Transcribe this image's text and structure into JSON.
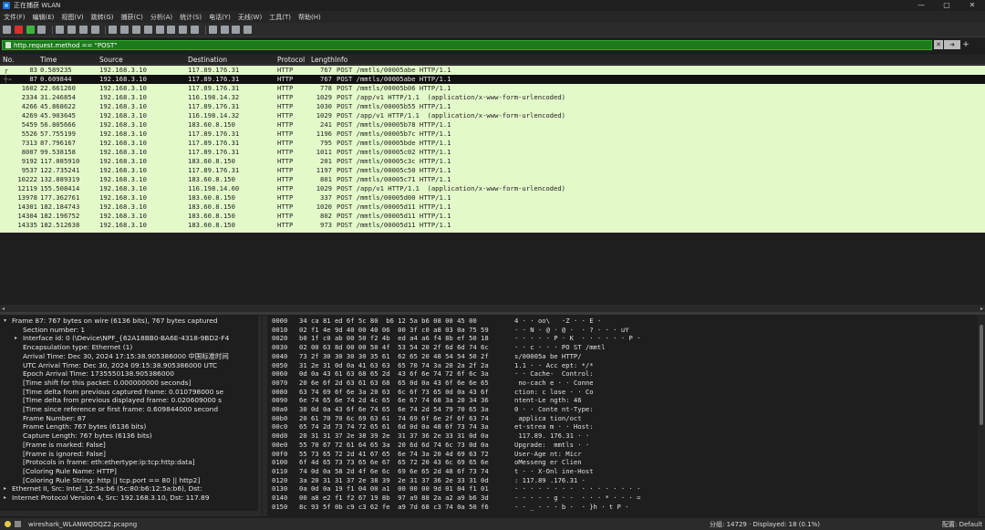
{
  "window": {
    "title": "正在捕获 WLAN",
    "controls": [
      "—",
      "▢",
      "✕"
    ]
  },
  "menu": [
    "文件(F)",
    "编辑(E)",
    "视图(V)",
    "跳转(G)",
    "捕获(C)",
    "分析(A)",
    "统计(S)",
    "电话(Y)",
    "无线(W)",
    "工具(T)",
    "帮助(H)"
  ],
  "filter": {
    "value": "http.request.method == \"POST\""
  },
  "columns": {
    "no": "No.",
    "time": "Time",
    "source": "Source",
    "destination": "Destination",
    "protocol": "Protocol",
    "length": "Length",
    "info": "Info"
  },
  "packets": [
    {
      "no": "83",
      "time": "0.589235",
      "src": "192.168.3.10",
      "dst": "117.89.176.31",
      "proto": "HTTP",
      "len": "767",
      "info": "POST /mmtls/00005abe HTTP/1.1"
    },
    {
      "no": "87",
      "time": "0.609844",
      "src": "192.168.3.10",
      "dst": "117.89.176.31",
      "proto": "HTTP",
      "len": "767",
      "info": "POST /mmtls/00005abe HTTP/1.1",
      "selected": true
    },
    {
      "no": "1602",
      "time": "22.661260",
      "src": "192.168.3.10",
      "dst": "117.89.176.31",
      "proto": "HTTP",
      "len": "778",
      "info": "POST /mmtls/00005b06 HTTP/1.1"
    },
    {
      "no": "2334",
      "time": "31.246854",
      "src": "192.168.3.10",
      "dst": "116.198.14.32",
      "proto": "HTTP",
      "len": "1029",
      "info": "POST /app/v1 HTTP/1.1  (application/x-www-form-urlencoded)"
    },
    {
      "no": "4266",
      "time": "45.868622",
      "src": "192.168.3.10",
      "dst": "117.89.176.31",
      "proto": "HTTP",
      "len": "1030",
      "info": "POST /mmtls/00005b55 HTTP/1.1"
    },
    {
      "no": "4269",
      "time": "45.903645",
      "src": "192.168.3.10",
      "dst": "116.198.14.32",
      "proto": "HTTP",
      "len": "1029",
      "info": "POST /app/v1 HTTP/1.1  (application/x-www-form-urlencoded)"
    },
    {
      "no": "5459",
      "time": "56.805666",
      "src": "192.168.3.10",
      "dst": "183.60.8.150",
      "proto": "HTTP",
      "len": "241",
      "info": "POST /mmtls/00005b78 HTTP/1.1"
    },
    {
      "no": "5526",
      "time": "57.755199",
      "src": "192.168.3.10",
      "dst": "117.89.176.31",
      "proto": "HTTP",
      "len": "1196",
      "info": "POST /mmtls/00005b7c HTTP/1.1"
    },
    {
      "no": "7313",
      "time": "87.796167",
      "src": "192.168.3.10",
      "dst": "117.89.176.31",
      "proto": "HTTP",
      "len": "795",
      "info": "POST /mmtls/00005bde HTTP/1.1"
    },
    {
      "no": "8007",
      "time": "99.538158",
      "src": "192.168.3.10",
      "dst": "117.89.176.31",
      "proto": "HTTP",
      "len": "1011",
      "info": "POST /mmtls/00005c02 HTTP/1.1"
    },
    {
      "no": "9192",
      "time": "117.085910",
      "src": "192.168.3.10",
      "dst": "183.60.8.150",
      "proto": "HTTP",
      "len": "201",
      "info": "POST /mmtls/00005c3c HTTP/1.1"
    },
    {
      "no": "9537",
      "time": "122.735241",
      "src": "192.168.3.10",
      "dst": "117.89.176.31",
      "proto": "HTTP",
      "len": "1197",
      "info": "POST /mmtls/00005c50 HTTP/1.1"
    },
    {
      "no": "10222",
      "time": "132.889319",
      "src": "192.168.3.10",
      "dst": "183.60.8.150",
      "proto": "HTTP",
      "len": "801",
      "info": "POST /mmtls/00005c71 HTTP/1.1"
    },
    {
      "no": "12119",
      "time": "155.508414",
      "src": "192.168.3.10",
      "dst": "116.198.14.60",
      "proto": "HTTP",
      "len": "1029",
      "info": "POST /app/v1 HTTP/1.1  (application/x-www-form-urlencoded)"
    },
    {
      "no": "13978",
      "time": "177.362761",
      "src": "192.168.3.10",
      "dst": "183.60.8.150",
      "proto": "HTTP",
      "len": "337",
      "info": "POST /mmtls/00005d00 HTTP/1.1"
    },
    {
      "no": "14301",
      "time": "182.184743",
      "src": "192.168.3.10",
      "dst": "183.60.8.150",
      "proto": "HTTP",
      "len": "1020",
      "info": "POST /mmtls/00005d11 HTTP/1.1"
    },
    {
      "no": "14304",
      "time": "182.196752",
      "src": "192.168.3.10",
      "dst": "183.60.8.150",
      "proto": "HTTP",
      "len": "802",
      "info": "POST /mmtls/00005d11 HTTP/1.1"
    },
    {
      "no": "14335",
      "time": "182.512638",
      "src": "192.168.3.10",
      "dst": "183.60.8.150",
      "proto": "HTTP",
      "len": "973",
      "info": "POST /mmtls/00005d11 HTTP/1.1"
    }
  ],
  "detail": [
    {
      "text": "Frame 87: 767 bytes on wire (6136 bits), 767 bytes captured",
      "indent": 0,
      "tri": "▾"
    },
    {
      "text": "Section number: 1",
      "indent": 1
    },
    {
      "text": "Interface id: 0 (\\Device\\NPF_{62A18BB0-BA6E-4318-9BD2-F4",
      "indent": 1,
      "tri": "▸"
    },
    {
      "text": "Encapsulation type: Ethernet (1)",
      "indent": 1
    },
    {
      "text": "Arrival Time: Dec 30, 2024 17:15:38.905386000 中国标准时间",
      "indent": 1
    },
    {
      "text": "UTC Arrival Time: Dec 30, 2024 09:15:38.905386000 UTC",
      "indent": 1
    },
    {
      "text": "Epoch Arrival Time: 1735550138.905386000",
      "indent": 1
    },
    {
      "text": "[Time shift for this packet: 0.000000000 seconds]",
      "indent": 1
    },
    {
      "text": "[Time delta from previous captured frame: 0.010798000 se",
      "indent": 1
    },
    {
      "text": "[Time delta from previous displayed frame: 0.020609000 s",
      "indent": 1
    },
    {
      "text": "[Time since reference or first frame: 0.609844000 second",
      "indent": 1
    },
    {
      "text": "Frame Number: 87",
      "indent": 1
    },
    {
      "text": "Frame Length: 767 bytes (6136 bits)",
      "indent": 1
    },
    {
      "text": "Capture Length: 767 bytes (6136 bits)",
      "indent": 1
    },
    {
      "text": "[Frame is marked: False]",
      "indent": 1
    },
    {
      "text": "[Frame is ignored: False]",
      "indent": 1
    },
    {
      "text": "[Protocols in frame: eth:ethertype:ip:tcp:http:data]",
      "indent": 1
    },
    {
      "text": "[Coloring Rule Name: HTTP]",
      "indent": 1
    },
    {
      "text": "[Coloring Rule String: http || tcp.port == 80 || http2]",
      "indent": 1
    },
    {
      "text": "Ethernet II, Src: Intel_12:5a:b6 (5c:80:b6:12:5a:b6), Dst:",
      "indent": 0,
      "tri": "▸"
    },
    {
      "text": "Internet Protocol Version 4, Src: 192.168.3.10, Dst: 117.89",
      "indent": 0,
      "tri": "▸"
    }
  ],
  "hex": [
    {
      "off": "0000",
      "bytes": "34 ca 81 ed 6f 5c 80  b6 12 5a b6 08 00 45 00",
      "ascii": "4 · · oo\\   ·Z · · E ·"
    },
    {
      "off": "0010",
      "bytes": "02 f1 4e 9d 40 00 40 06  00 3f c0 a8 03 0a 75 59",
      "ascii": "· · N · @ · @ ·  · ? · · · uY"
    },
    {
      "off": "0020",
      "bytes": "b0 1f c0 ab 00 50 f2 4b  ed a4 a6 f4 8b ef 50 18",
      "ascii": "· · · · · P · K  · · · · · · P ·"
    },
    {
      "off": "0030",
      "bytes": "02 00 63 8d 00 00 50 4f  53 54 20 2f 6d 6d 74 6c",
      "ascii": "· · c · · · PO ST /mmtl"
    },
    {
      "off": "0040",
      "bytes": "73 2f 30 30 30 30 35 61  62 65 20 48 54 54 50 2f",
      "ascii": "s/00005a be HTTP/"
    },
    {
      "off": "0050",
      "bytes": "31 2e 31 0d 0a 41 63 63  65 70 74 3a 20 2a 2f 2a",
      "ascii": "1.1 · · Acc ept: */*"
    },
    {
      "off": "0060",
      "bytes": "0d 0a 43 61 63 68 65 2d  43 6f 6e 74 72 6f 6c 3a",
      "ascii": "· · Cache-  Control:"
    },
    {
      "off": "0070",
      "bytes": "20 6e 6f 2d 63 61 63 68  65 0d 0a 43 6f 6e 6e 65",
      "ascii": " no-cach e · · Conne"
    },
    {
      "off": "0080",
      "bytes": "63 74 69 6f 6e 3a 20 63  6c 6f 73 65 0d 0a 43 6f",
      "ascii": "ction: c lose · · Co"
    },
    {
      "off": "0090",
      "bytes": "6e 74 65 6e 74 2d 4c 65  6e 67 74 68 3a 20 34 36",
      "ascii": "ntent-Le ngth: 46"
    },
    {
      "off": "00a0",
      "bytes": "30 0d 0a 43 6f 6e 74 65  6e 74 2d 54 79 70 65 3a",
      "ascii": "0 · · Conte nt-Type:"
    },
    {
      "off": "00b0",
      "bytes": "20 61 70 70 6c 69 63 61  74 69 6f 6e 2f 6f 63 74",
      "ascii": " applica tion/oct"
    },
    {
      "off": "00c0",
      "bytes": "65 74 2d 73 74 72 65 61  6d 0d 0a 48 6f 73 74 3a",
      "ascii": "et-strea m · · Host:"
    },
    {
      "off": "00d0",
      "bytes": "20 31 31 37 2e 38 39 2e  31 37 36 2e 33 31 0d 0a",
      "ascii": " 117.89. 176.31 · ·"
    },
    {
      "off": "00e0",
      "bytes": "55 70 67 72 61 64 65 3a  20 6d 6d 74 6c 73 0d 0a",
      "ascii": "Upgrade:  mmtls · ·"
    },
    {
      "off": "00f0",
      "bytes": "55 73 65 72 2d 41 67 65  6e 74 3a 20 4d 69 63 72",
      "ascii": "User-Age nt: Micr"
    },
    {
      "off": "0100",
      "bytes": "6f 4d 65 73 73 65 6e 67  65 72 20 43 6c 69 65 6e",
      "ascii": "oMesseng er Clien"
    },
    {
      "off": "0110",
      "bytes": "74 0d 0a 58 2d 4f 6e 6c  69 6e 65 2d 48 6f 73 74",
      "ascii": "t · · X-Onl ine-Host"
    },
    {
      "off": "0120",
      "bytes": "3a 20 31 31 37 2e 38 39  2e 31 37 36 2e 33 31 0d",
      "ascii": ": 117.89 .176.31 ·"
    },
    {
      "off": "0130",
      "bytes": "0a 0d 0a 19 f1 04 00 a1  00 00 00 9d 01 04 f1 01",
      "ascii": "· · · · · · · ·  · · · · · · · ·"
    },
    {
      "off": "0140",
      "bytes": "00 a8 e2 f1 f2 67 19 8b  97 a9 88 2a a2 a9 b6 3d",
      "ascii": "· · · · · g · ·  · · · * · · · ="
    },
    {
      "off": "0150",
      "bytes": "8c 93 5f 0b c9 c3 62 fe  a9 7d 68 c3 74 0a 50 f6",
      "ascii": "· · _ · · · b ·  · }h · t P ·"
    }
  ],
  "status": {
    "file": "wireshark_WLANWQDQZ2.pcapng",
    "packets": "分组: 14729 · Displayed: 18 (0.1%)",
    "profile": "配置: Default"
  }
}
